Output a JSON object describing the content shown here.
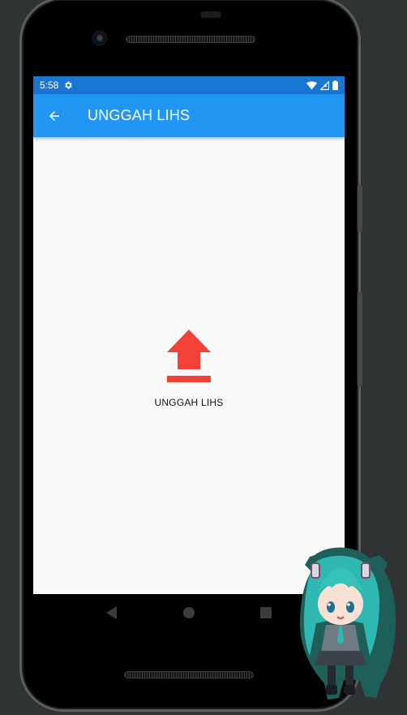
{
  "status_bar": {
    "time": "5:58",
    "icons": [
      "settings-gear-icon",
      "wifi-icon",
      "no-signal-icon",
      "battery-icon"
    ]
  },
  "app_bar": {
    "title": "UNGGAH LIHS",
    "back_icon": "arrow-back-icon"
  },
  "main": {
    "upload_icon": "upload-arrow-icon",
    "upload_label": "UNGGAH LIHS"
  },
  "nav_bar": {
    "buttons": [
      "back-triangle-icon",
      "home-circle-icon",
      "recents-square-icon"
    ]
  },
  "colors": {
    "status_bar": "#1976d2",
    "app_bar": "#2196f3",
    "upload_icon": "#f44336",
    "screen_background": "#fafafa"
  }
}
